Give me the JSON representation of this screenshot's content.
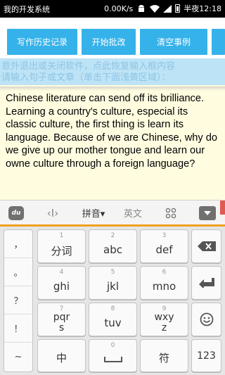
{
  "status_bar": {
    "title": "我的开发系统",
    "speed": "0.00K/s",
    "time": "半夜12:18"
  },
  "toolbar": {
    "history_label": "写作历史记录",
    "start_label": "开始批改",
    "clear_label": "清空事例"
  },
  "hint": {
    "line1": "意外退出或关闭软件，点此恢复输入框内容",
    "line2": "请输入句子或文章（单击下面浅黄区域）："
  },
  "editor": {
    "text": "Chinese literature can send off its brilliance. Learning a country's culture, especial its classic culture, the first thing is learn its language. Because of we are Chinese, why do we give up our mother tongue and learn our owne culture through a foreign language?"
  },
  "ime_bar": {
    "logo": "du",
    "cursor_glyph": "‹I›",
    "pinyin_label": "拼音▾",
    "english_label": "英文",
    "icons": {
      "logo": "baidu-ime-logo-icon",
      "cursor": "cursor-move-icon",
      "grid": "grid-icon",
      "hide": "hide-keyboard-icon"
    }
  },
  "keyboard": {
    "punct": [
      "，",
      "。",
      "？",
      "！",
      "~"
    ],
    "keys": [
      {
        "num": "1",
        "label": "分词"
      },
      {
        "num": "2",
        "label": "abc"
      },
      {
        "num": "3",
        "label": "def"
      },
      {
        "num": "4",
        "label": "ghi"
      },
      {
        "num": "5",
        "label": "jkl"
      },
      {
        "num": "6",
        "label": "mno"
      },
      {
        "num": "7",
        "label": "pqr",
        "label2": "s"
      },
      {
        "num": "8",
        "label": "tuv"
      },
      {
        "num": "9",
        "label": "wxy",
        "label2": "z"
      }
    ],
    "zh_label": "中",
    "space_num": "0",
    "symbol_label": "符",
    "num_label": "123"
  },
  "colors": {
    "button_bg": "#35b2ea",
    "hint_bg": "#bde3f6",
    "editor_bg": "#fffce0",
    "ime_accent": "#f0a020"
  }
}
